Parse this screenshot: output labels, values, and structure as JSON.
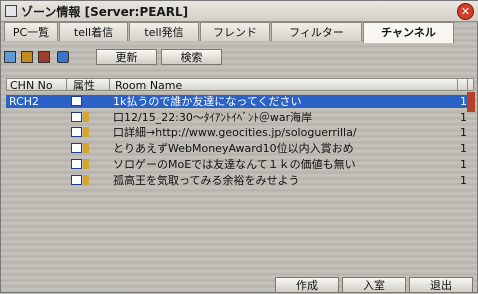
{
  "window": {
    "title": "ゾーン情報 [Server:PEARL]",
    "close_symbol": "✕"
  },
  "tabs": [
    {
      "label": "PC一覧"
    },
    {
      "label": "tell着信"
    },
    {
      "label": "tell発信"
    },
    {
      "label": "フレンド"
    },
    {
      "label": "フィルター"
    },
    {
      "label": "チャンネル",
      "active": true
    }
  ],
  "toolbar": {
    "icons": [
      "all-icon",
      "ranking-icon",
      "book-icon",
      "group-icon"
    ],
    "update_label": "更新",
    "search_label": "検索"
  },
  "grid": {
    "headers": {
      "no": "CHN No",
      "attr": "属性",
      "name": "Room Name"
    },
    "rows": [
      {
        "no": "RCH2",
        "name": "1k払うので誰か友達になってください",
        "count": "1",
        "selected": true,
        "key": false
      },
      {
        "no": "",
        "name": "口12/15_22:30〜ﾀｲｱﾝﾄｲﾍﾞﾝﾄ＠war海岸",
        "count": "1",
        "key": true
      },
      {
        "no": "",
        "name": "口詳細→http://www.geocities.jp/sologuerrilla/",
        "count": "1",
        "key": true
      },
      {
        "no": "",
        "name": "とりあえずWebMoneyAward10位以内入賞おめ",
        "count": "1",
        "key": true
      },
      {
        "no": "",
        "name": "ソロゲーのMoEでは友達なんて１ｋの価値も無い",
        "count": "1",
        "key": true
      },
      {
        "no": "",
        "name": "孤高王を気取ってみる余裕をみせよう",
        "count": "1",
        "key": true
      }
    ]
  },
  "bottom": {
    "create_label": "作成",
    "enter_label": "入室",
    "exit_label": "退出"
  }
}
